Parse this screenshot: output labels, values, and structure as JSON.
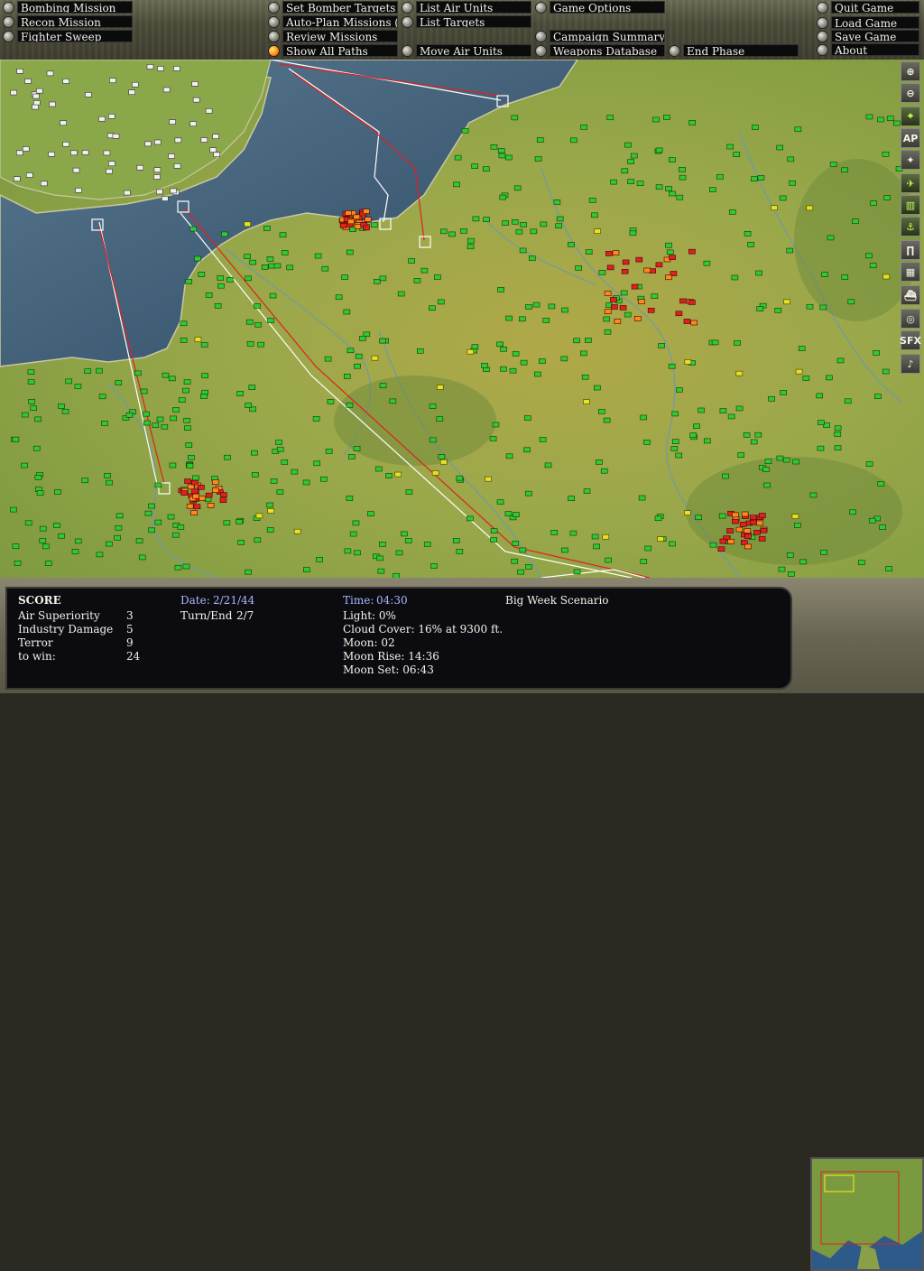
{
  "menu": {
    "col1": [
      "Bombing Mission",
      "Recon Mission",
      "Fighter Sweep"
    ],
    "col2": [
      "Set Bomber Targets",
      "Auto-Plan Missions (Off)",
      "Review Missions",
      "Show All Paths"
    ],
    "col3": [
      "List Air Units",
      "List Targets",
      "Move Air Units"
    ],
    "col4": [
      "Game Options",
      "Campaign Summary",
      "Weapons Database"
    ],
    "end_phase": "End Phase",
    "col5": [
      "Quit Game",
      "Load Game",
      "Save Game",
      "About"
    ]
  },
  "toolbar": [
    "zoom-in",
    "zoom-out",
    "target",
    "AP",
    "compass",
    "aircraft",
    "factory",
    "anchor",
    "bridge",
    "building",
    "ship",
    "radar",
    "SFX",
    "music"
  ],
  "toolbar_labels": {
    "ap": "AP",
    "sfx": "SFX"
  },
  "score": {
    "title": "SCORE",
    "rows": [
      {
        "label": "Air Superiority",
        "value": "3"
      },
      {
        "label": "Industry Damage",
        "value": "5"
      },
      {
        "label": "Terror",
        "value": "9"
      },
      {
        "label": "to win:",
        "value": "24"
      }
    ]
  },
  "date": {
    "label": "Date:",
    "value": "2/21/44"
  },
  "turn": {
    "label": "Turn/End",
    "value": "2/7"
  },
  "time": {
    "label": "Time:",
    "value": "04:30"
  },
  "conditions": {
    "light": "Light: 0%",
    "cloud": "Cloud Cover: 16% at 9300 ft.",
    "moon": "Moon: 02",
    "moonrise": "Moon Rise: 14:36",
    "moonset": "Moon Set: 06:43"
  },
  "scenario": "Big Week Scenario",
  "colors": {
    "sea": "#3a5670",
    "land": "#9aa84a",
    "allied_unit": "#32c832",
    "friendly_marker": "#e8e020",
    "axis_unit": "#e02020",
    "axis_orange": "#ff8a1a",
    "path_red": "#e02020",
    "path_white": "#ffffff"
  }
}
